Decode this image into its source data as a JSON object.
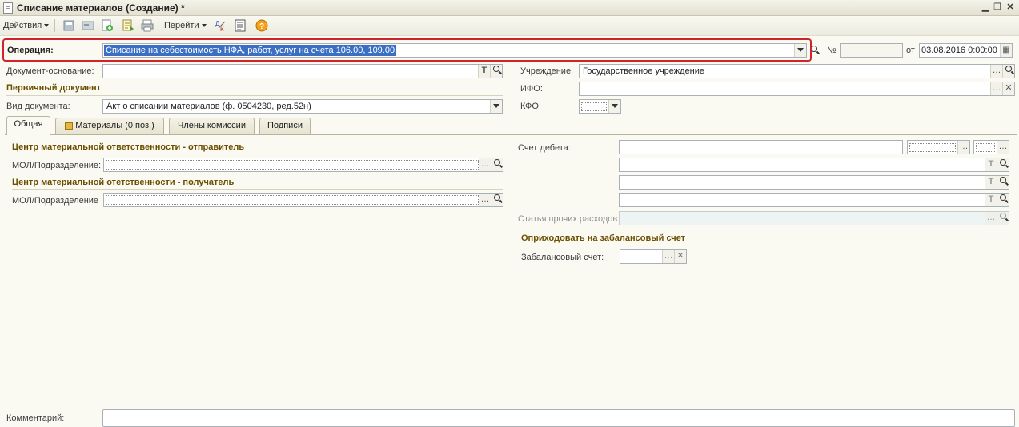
{
  "window": {
    "title": "Списание материалов (Создание) *"
  },
  "toolbar": {
    "actions_label": "Действия",
    "goto_label": "Перейти"
  },
  "header": {
    "operation_label": "Операция:",
    "operation_value": "Списание на себестоимость НФА, работ, услуг на счета 106.00, 109.00",
    "number_label": "№",
    "number_value": "",
    "date_label": "от",
    "date_value": "03.08.2016  0:00:00",
    "basis_doc_label": "Документ-основание:",
    "basis_doc_value": "",
    "institution_label": "Учреждение:",
    "institution_value": "Государственное учреждение",
    "primary_doc_section": "Первичный документ",
    "ifo_label": "ИФО:",
    "ifo_value": "",
    "doc_type_label": "Вид документа:",
    "doc_type_value": "Акт о списании материалов (ф. 0504230, ред.52н)",
    "kfo_label": "КФО:",
    "kfo_value": ""
  },
  "tabs": [
    {
      "label": "Общая",
      "active": true
    },
    {
      "label": "Материалы (0 поз.)",
      "active": false
    },
    {
      "label": "Члены комиссии",
      "active": false
    },
    {
      "label": "Подписи",
      "active": false
    }
  ],
  "general": {
    "sender_section": "Центр материальной ответственности - отправитель",
    "sender_mol_label": "МОЛ/Подразделение:",
    "receiver_section": "Центр материальной отетственности - получатель",
    "receiver_mol_label": "МОЛ/Подразделение",
    "debit_account_label": "Счет дебета:",
    "other_expenses_label": "Статья прочих расходов:",
    "offbalance_section": "Оприходовать на забалансовый счет",
    "offbalance_account_label": "Забалансовый счет:"
  },
  "footer": {
    "comment_label": "Комментарий:",
    "comment_value": ""
  },
  "colors": {
    "highlight": "#d2222a",
    "section_text": "#6b4f00",
    "selection": "#3a6fc4"
  }
}
